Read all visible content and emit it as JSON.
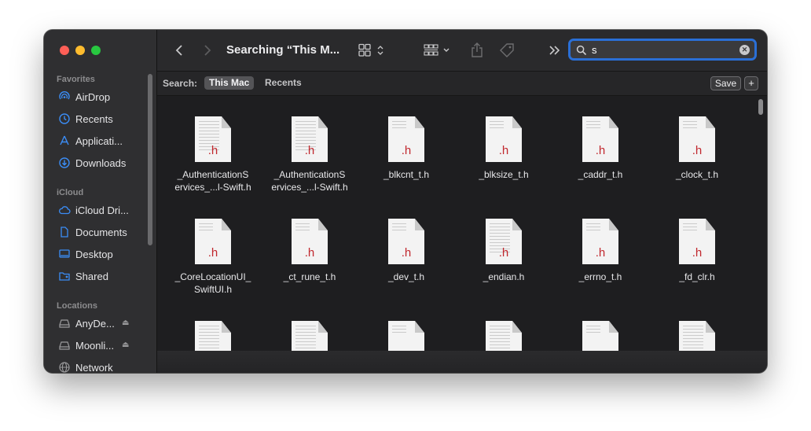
{
  "window": {
    "title": "Searching “This M...",
    "search_value": "s",
    "colors": {
      "accent": "#2a6fd6",
      "file_ext": "#c1272d"
    }
  },
  "sidebar": {
    "favorites_title": "Favorites",
    "favorites": [
      {
        "label": "AirDrop",
        "icon": "airdrop-icon"
      },
      {
        "label": "Recents",
        "icon": "clock-icon"
      },
      {
        "label": "Applicati...",
        "icon": "applications-icon"
      },
      {
        "label": "Downloads",
        "icon": "download-icon"
      }
    ],
    "icloud_title": "iCloud",
    "icloud": [
      {
        "label": "iCloud Dri...",
        "icon": "cloud-icon"
      },
      {
        "label": "Documents",
        "icon": "document-icon"
      },
      {
        "label": "Desktop",
        "icon": "desktop-icon"
      },
      {
        "label": "Shared",
        "icon": "shared-folder-icon"
      }
    ],
    "locations_title": "Locations",
    "locations": [
      {
        "label": "AnyDe...",
        "icon": "drive-icon",
        "eject": "⏏"
      },
      {
        "label": "Moonli...",
        "icon": "drive-icon",
        "eject": "⏏"
      },
      {
        "label": "Network",
        "icon": "network-icon"
      }
    ]
  },
  "scope": {
    "label": "Search:",
    "this_mac": "This Mac",
    "recents": "Recents",
    "save": "Save",
    "plus": "+"
  },
  "files": [
    {
      "ext": ".h",
      "line1": "_AuthenticationS",
      "line2": "ervices_...l-Swift.h"
    },
    {
      "ext": ".h",
      "line1": "_AuthenticationS",
      "line2": "ervices_...l-Swift.h"
    },
    {
      "ext": ".h",
      "line1": "_blkcnt_t.h",
      "line2": ""
    },
    {
      "ext": ".h",
      "line1": "_blksize_t.h",
      "line2": ""
    },
    {
      "ext": ".h",
      "line1": "_caddr_t.h",
      "line2": ""
    },
    {
      "ext": ".h",
      "line1": "_clock_t.h",
      "line2": ""
    },
    {
      "ext": ".h",
      "line1": "_CoreLocationUI_",
      "line2": "SwiftUI.h"
    },
    {
      "ext": ".h",
      "line1": "_ct_rune_t.h",
      "line2": ""
    },
    {
      "ext": ".h",
      "line1": "_dev_t.h",
      "line2": ""
    },
    {
      "ext": ".h",
      "line1": "_endian.h",
      "line2": ""
    },
    {
      "ext": ".h",
      "line1": "_errno_t.h",
      "line2": ""
    },
    {
      "ext": ".h",
      "line1": "_fd_clr.h",
      "line2": ""
    }
  ]
}
